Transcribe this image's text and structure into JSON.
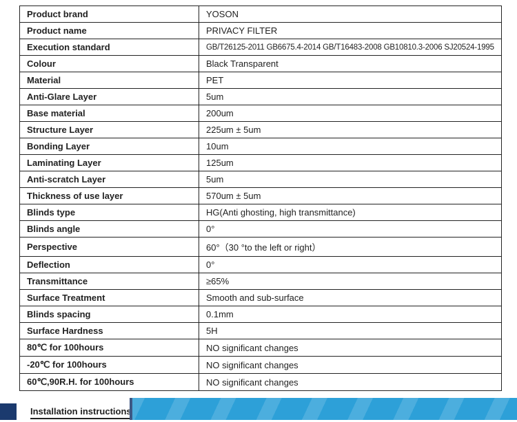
{
  "specs": [
    {
      "label": "Product brand",
      "value": "YOSON"
    },
    {
      "label": "Product name",
      "value": "PRIVACY FILTER"
    },
    {
      "label": "Execution standard",
      "value": "GB/T26125-2011   GB6675.4-2014   GB/T16483-2008   GB10810.3-2006   SJ20524-1995",
      "small": true
    },
    {
      "label": "Colour",
      "value": "Black Transparent"
    },
    {
      "label": "Material",
      "value": "PET"
    },
    {
      "label": "Anti-Glare Layer",
      "value": "5um"
    },
    {
      "label": "Base material",
      "value": "200um"
    },
    {
      "label": "Structure Layer",
      "value": "225um ± 5um"
    },
    {
      "label": "Bonding Layer",
      "value": "10um"
    },
    {
      "label": "Laminating Layer",
      "value": "125um"
    },
    {
      "label": "Anti-scratch Layer",
      "value": "5um"
    },
    {
      "label": "Thickness of use layer",
      "value": "570um ± 5um"
    },
    {
      "label": "Blinds type",
      "value": "HG(Anti ghosting, high transmittance)"
    },
    {
      "label": "Blinds angle",
      "value": "0°"
    },
    {
      "label": "Perspective",
      "value": "60°（30 °to the left or right）"
    },
    {
      "label": "Deflection",
      "value": "0°"
    },
    {
      "label": "Transmittance",
      "value": "≥65%"
    },
    {
      "label": "Surface Treatment",
      "value": "Smooth and sub-surface"
    },
    {
      "label": "Blinds spacing",
      "value": "0.1mm"
    },
    {
      "label": "Surface Hardness",
      "value": "5H"
    },
    {
      "label": "80℃ for 100hours",
      "value": "NO significant changes"
    },
    {
      "label": "-20℃ for 100hours",
      "value": "NO significant changes"
    },
    {
      "label": "60℃,90R.H. for 100hours",
      "value": "NO significant changes"
    }
  ],
  "footer": {
    "install_label": "Installation instructions"
  }
}
